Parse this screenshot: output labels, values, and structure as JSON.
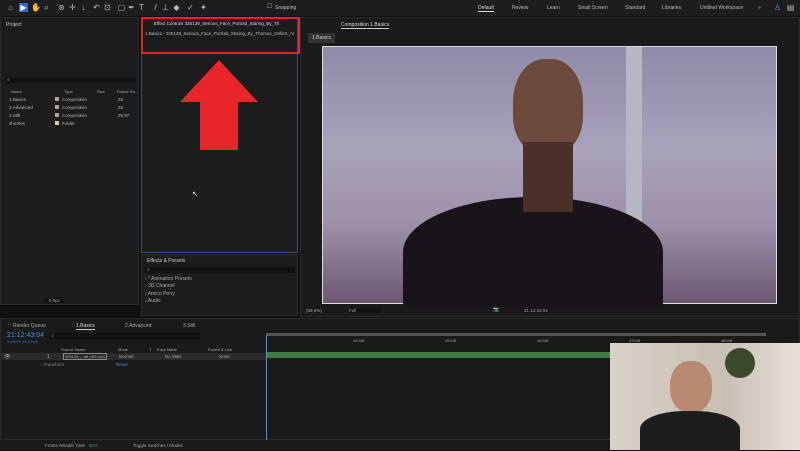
{
  "workspaces": [
    "Default",
    "Review",
    "Learn",
    "Small Screen",
    "Standard",
    "Libraries",
    "Untitled Workspace"
  ],
  "toolbar": {
    "snapping": "Snapping"
  },
  "project": {
    "title": "Project",
    "search_placeholder": "",
    "columns": [
      "Name",
      "Type",
      "Size",
      "Frame Ra..."
    ],
    "items": [
      {
        "name": "1.Basics",
        "type": "Composition",
        "fps": "25"
      },
      {
        "name": "2.Advanced",
        "type": "Composition",
        "fps": "25"
      },
      {
        "name": "3.Still",
        "type": "Composition",
        "fps": "29,97"
      },
      {
        "name": "shizzles",
        "type": "Folder",
        "fps": ""
      }
    ],
    "bpc": "8 bpc"
  },
  "effect_controls": {
    "tab": "Effect Controls 326128_Serious_Face_Portrait_Staring_By_Th",
    "layer": "1.Basics - 326128_Serious_Face_Portrait_Staring_By_Thomas_Gellert_Ar"
  },
  "effects_presets": {
    "title": "Effects & Presets",
    "items": [
      "* Animation Presets",
      "3D Channel",
      "Amico Perry",
      "Audio"
    ]
  },
  "composition": {
    "tab": "Composition 1.Basics",
    "crumb": "1.Basics",
    "zoom": "(68,6%)",
    "resolution": "Full",
    "timecode": "21:12:43:04"
  },
  "timeline": {
    "tabs": [
      "Render Queue",
      "1.Basics",
      "2.Advanced",
      "3.Still"
    ],
    "timecode": "21:12:43:04",
    "frames": "1908079 (25.00 fps)",
    "columns": [
      "Source Name",
      "Mode",
      "T",
      "Track Matte",
      "Parent & Link"
    ],
    "layer": {
      "index": "1",
      "name": "326128_...ait_HD.mp4",
      "mode": "Normal",
      "matte": "No Matt",
      "parent": "None"
    },
    "transform": "Transform",
    "reset": "Reset",
    "ruler": [
      "44:04f",
      "45:04f",
      "46:04f",
      "47:04f",
      "48:04f"
    ]
  },
  "status": {
    "render_label": "Frame Render Time",
    "render_value": "0ms",
    "toggle": "Toggle Switches / Modes"
  },
  "colors": {
    "accent": "#2d8ceb",
    "highlight": "#e0242a",
    "arrow": "#e8262a"
  }
}
